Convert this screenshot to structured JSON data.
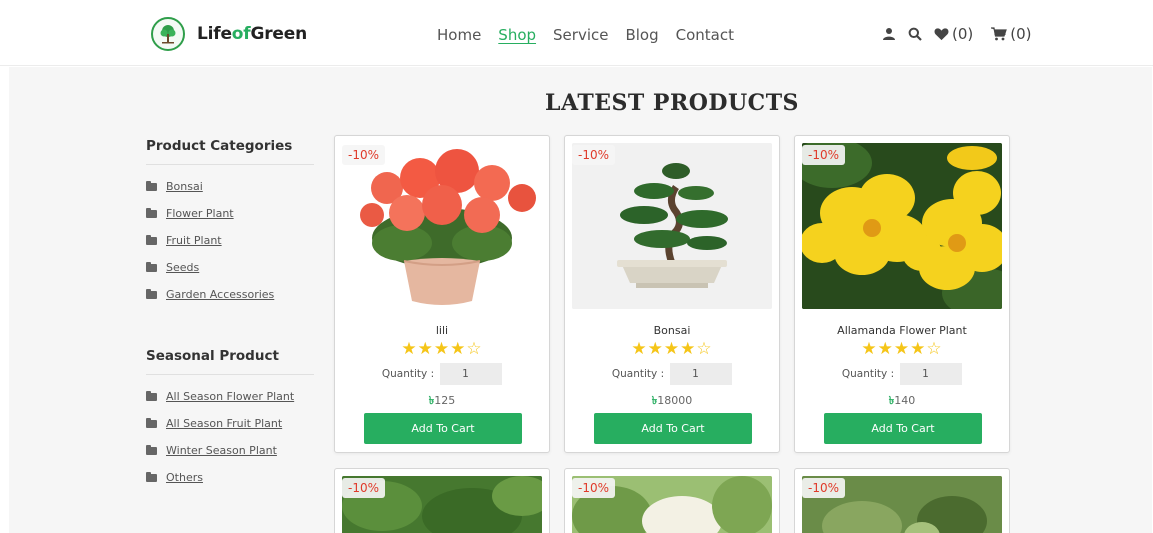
{
  "brand": {
    "prefix": "Life",
    "middle": "of",
    "suffix": "Green",
    "logo_icon": "tree-logo-icon"
  },
  "nav": {
    "items": [
      "Home",
      "Shop",
      "Service",
      "Blog",
      "Contact"
    ],
    "active": "Shop"
  },
  "toolbar": {
    "user_icon": "user-icon",
    "search_icon": "search-icon",
    "wishlist_count": "(0)",
    "cart_count": "(0)"
  },
  "main": {
    "title": "LATEST PRODUCTS"
  },
  "sidebar": {
    "categories_heading": "Product Categories",
    "categories": [
      "Bonsai",
      "Flower Plant",
      "Fruit Plant",
      "Seeds",
      "Garden Accessories"
    ],
    "seasonal_heading": "Seasonal Product",
    "seasonal": [
      "All Season Flower Plant",
      "All Season Fruit Plant",
      "Winter Season Plant",
      "Others"
    ]
  },
  "products": [
    {
      "name": "lili",
      "discount": "-10%",
      "rating": 4,
      "rating_max": 5,
      "quantity_label": "Quantity :",
      "quantity": "1",
      "currency": "৳",
      "price": "125",
      "button": "Add To Cart"
    },
    {
      "name": "Bonsai",
      "discount": "-10%",
      "rating": 4,
      "rating_max": 5,
      "quantity_label": "Quantity :",
      "quantity": "1",
      "currency": "৳",
      "price": "18000",
      "button": "Add To Cart"
    },
    {
      "name": "Allamanda Flower Plant",
      "discount": "-10%",
      "rating": 4,
      "rating_max": 5,
      "quantity_label": "Quantity :",
      "quantity": "1",
      "currency": "৳",
      "price": "140",
      "button": "Add To Cart"
    }
  ],
  "next_row": [
    {
      "discount": "-10%"
    },
    {
      "discount": "-10%"
    },
    {
      "discount": "-10%"
    }
  ],
  "colors": {
    "accent": "#27ae60",
    "discount": "#e03a2a",
    "star": "#f5c518"
  }
}
